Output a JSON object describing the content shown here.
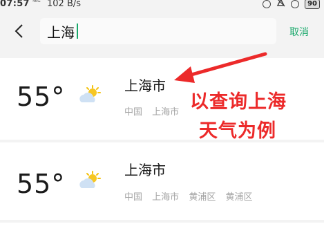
{
  "status_bar": {
    "time": "07:57",
    "signal": "⁴⁶ᴳ",
    "network_speed": "102 B/s",
    "battery": "90"
  },
  "search": {
    "query": "上海",
    "cancel_label": "取消"
  },
  "results": [
    {
      "temperature": "55°",
      "weather_icon": "partly-cloudy-icon",
      "city": "上海市",
      "region": [
        "中国",
        "上海市"
      ]
    },
    {
      "temperature": "55°",
      "weather_icon": "partly-cloudy-icon",
      "city": "上海市",
      "region": [
        "中国",
        "上海市",
        "黄浦区",
        "黄浦区"
      ]
    }
  ],
  "annotation": {
    "line1": "以查询上海",
    "line2": "天气为例",
    "color": "#ec2a2a"
  },
  "colors": {
    "accent": "#18a86b",
    "background": "#f3f3f3",
    "card": "#ffffff"
  }
}
